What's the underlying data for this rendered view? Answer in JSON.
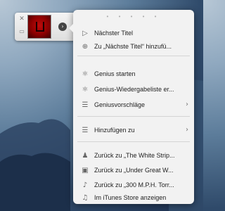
{
  "miniplayer": {
    "close_glyph": "✕",
    "mini_glyph": "▭",
    "arrow_glyph": "›"
  },
  "menu": {
    "dots": "• • • • •",
    "items": [
      {
        "label": "Nächster Titel",
        "icon": "next-track-icon",
        "glyph": "▷"
      },
      {
        "label": "Zu „Nächste Titel“ hinzufü...",
        "icon": "add-icon",
        "glyph": "⊕"
      },
      {
        "label": "Genius starten",
        "icon": "genius-icon",
        "glyph": "⚛"
      },
      {
        "label": "Genius-Wiedergabeliste er...",
        "icon": "genius-icon",
        "glyph": "⚛"
      },
      {
        "label": "Geniusvorschläge",
        "icon": "list-icon",
        "glyph": "☰",
        "submenu": "›"
      },
      {
        "label": "Hinzufügen zu",
        "icon": "add-to-list-icon",
        "glyph": "☰",
        "submenu": "›"
      },
      {
        "label": "Zurück zu „The White Strip...",
        "icon": "artist-icon",
        "glyph": "♟"
      },
      {
        "label": "Zurück zu „Under Great W...",
        "icon": "album-icon",
        "glyph": "▣"
      },
      {
        "label": "Zurück zu „300 M.P.H. Torr...",
        "icon": "song-icon",
        "glyph": "♪"
      },
      {
        "label": "Im iTunes Store anzeigen",
        "icon": "itunes-store-icon",
        "glyph": "♫"
      }
    ]
  }
}
